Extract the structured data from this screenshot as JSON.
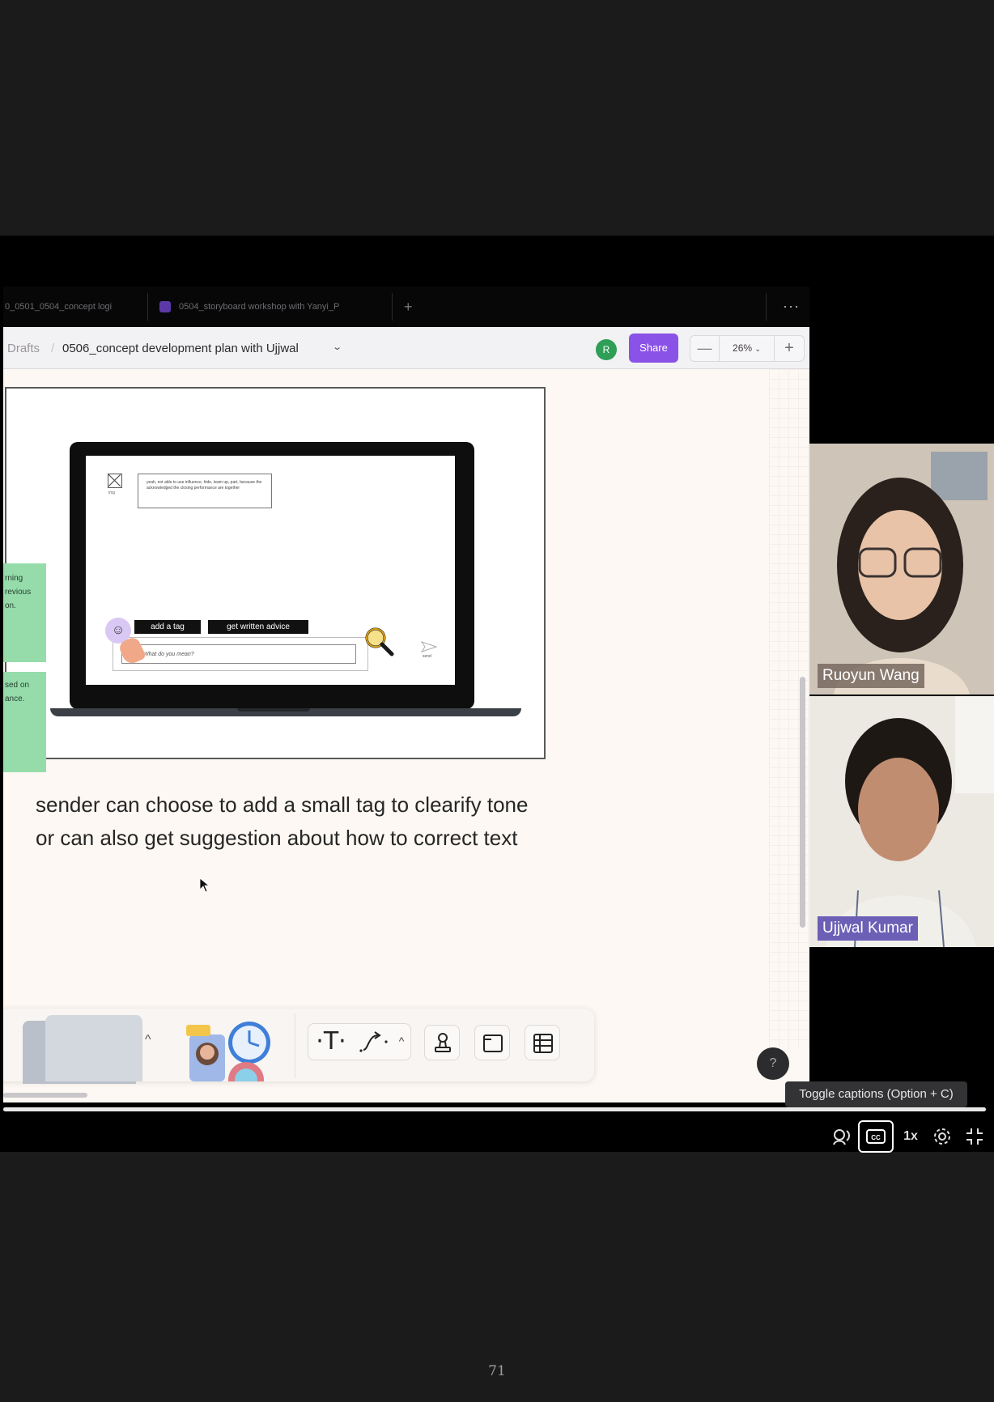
{
  "figma": {
    "tabs": [
      {
        "label": "0_0501_0504_concept logi"
      },
      {
        "label": "0504_storyboard workshop with Yanyi_P"
      }
    ],
    "breadcrumb": {
      "root": "Drafts",
      "separator": "/",
      "file": "0506_concept development plan with Ujjwal"
    },
    "avatar_initial": "R",
    "share_label": "Share",
    "zoom": {
      "minus": "—",
      "value": "26%",
      "plus": "+"
    },
    "more": "···",
    "help": "?"
  },
  "canvas": {
    "sticky_notes": [
      {
        "text": "rning\nrevious\non."
      },
      {
        "text": "sed on\nance."
      }
    ],
    "mockup": {
      "message_text": "yeah, not able to use influence, hide, team up, part, because the acknowledged the closing performance are together",
      "image_label": "img",
      "tag_button": "add a tag",
      "advice_button": "get written advice",
      "input_placeholder": "What do you mean?",
      "send_label": "send"
    },
    "description": "sender can choose to add a small tag to clearify tone or can also get suggestion about how to correct text"
  },
  "toolbar": {
    "text_tool": "T",
    "chevron": "^",
    "up_chevron": "^"
  },
  "participants": [
    {
      "name": "Ruoyun Wang"
    },
    {
      "name": "Ujjwal Kumar"
    }
  ],
  "player": {
    "tooltip": "Toggle captions (Option + C)",
    "speed": "1x",
    "cc_label": "CC",
    "progress": 1.0
  },
  "page_number": "71",
  "colors": {
    "share": "#8a52e6",
    "avatar": "#2f9e57",
    "sticky": "#95dcaa",
    "name_tag_active": "#6b5fb6"
  }
}
